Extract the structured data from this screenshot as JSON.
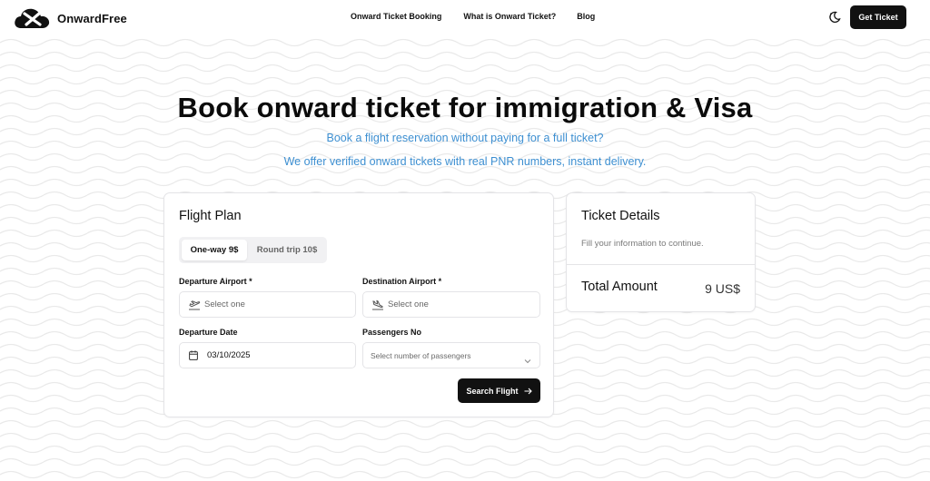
{
  "header": {
    "logo_text": "OnwardFree",
    "nav": [
      "Onward Ticket Booking",
      "What is Onward Ticket?",
      "Blog"
    ],
    "cta_label": "Get Ticket"
  },
  "hero": {
    "title": "Book onward ticket for immigration & Visa",
    "subtitle_1": "Book a flight reservation without paying for a full ticket?",
    "subtitle_2": "We offer verified onward tickets with real PNR numbers, instant delivery."
  },
  "flight_plan": {
    "title": "Flight Plan",
    "tabs": [
      "One-way 9$",
      "Round trip 10$"
    ],
    "selected_tab": "One-way 9$",
    "departure_airport": {
      "label": "Departure Airport *",
      "placeholder": "Select one",
      "icon": "plane-takeoff-icon"
    },
    "destination_airport": {
      "label": "Destination Airport *",
      "placeholder": "Select one",
      "icon": "plane-landing-icon"
    },
    "departure_date": {
      "label": "Departure Date",
      "value": "03/10/2025",
      "icon": "calendar-icon"
    },
    "passengers": {
      "label": "Passengers No",
      "placeholder": "Select number of passengers",
      "icon": "chevron-down-icon"
    },
    "search_label": "Search Flight"
  },
  "ticket_details": {
    "title": "Ticket Details",
    "hint": "Fill your information to continue.",
    "total_label": "Total Amount",
    "total_value": "9 US$"
  },
  "colors": {
    "accent_blue": "#3d8fd1",
    "primary_dark": "#111111",
    "border": "#e4e4e7"
  }
}
